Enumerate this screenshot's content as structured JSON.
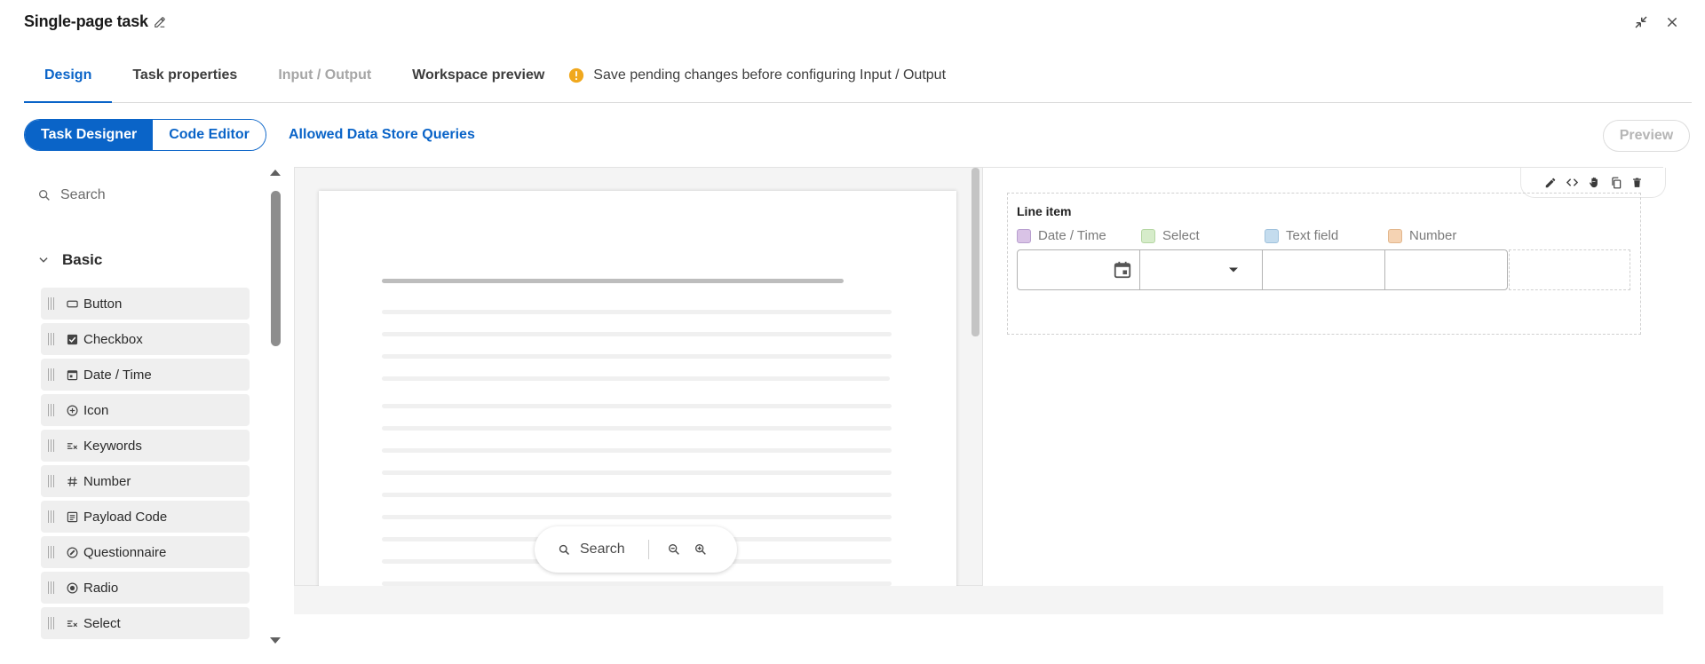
{
  "header": {
    "title": "Single-page task",
    "icons": {
      "edit": "edit-pencil-icon",
      "collapse": "collapse-icon",
      "close": "close-icon"
    }
  },
  "tabs": [
    {
      "label": "Design",
      "state": "active"
    },
    {
      "label": "Task properties",
      "state": "normal"
    },
    {
      "label": "Input / Output",
      "state": "disabled"
    },
    {
      "label": "Workspace preview",
      "state": "normal"
    }
  ],
  "warning": {
    "text": "Save pending changes before configuring Input / Output",
    "color": "#f0a81e"
  },
  "toolbar": {
    "segments": [
      "Task Designer",
      "Code Editor"
    ],
    "active_segment": "Task Designer",
    "allowed_queries_label": "Allowed Data Store Queries",
    "preview_label": "Preview"
  },
  "palette": {
    "search_placeholder": "Search",
    "group_label": "Basic",
    "items": [
      {
        "label": "Button",
        "icon": "button-icon"
      },
      {
        "label": "Checkbox",
        "icon": "checkbox-icon"
      },
      {
        "label": "Date / Time",
        "icon": "calendar-icon"
      },
      {
        "label": "Icon",
        "icon": "add-circle-icon"
      },
      {
        "label": "Keywords",
        "icon": "keywords-icon"
      },
      {
        "label": "Number",
        "icon": "hash-icon"
      },
      {
        "label": "Payload Code",
        "icon": "code-block-icon"
      },
      {
        "label": "Questionnaire",
        "icon": "questionnaire-icon"
      },
      {
        "label": "Radio",
        "icon": "radio-icon"
      },
      {
        "label": "Select",
        "icon": "select-list-icon"
      }
    ]
  },
  "doc_viewer": {
    "search_label": "Search",
    "icons": [
      "zoom-out-icon",
      "zoom-in-icon"
    ]
  },
  "line_item": {
    "title": "Line item",
    "columns": [
      {
        "label": "Date / Time",
        "color": "#d9c3e6"
      },
      {
        "label": "Select",
        "color": "#d6ecca"
      },
      {
        "label": "Text field",
        "color": "#c4dcee"
      },
      {
        "label": "Number",
        "color": "#f5d3b3"
      }
    ]
  },
  "colors": {
    "accent": "#0a64c8",
    "warning": "#f0a81e"
  }
}
